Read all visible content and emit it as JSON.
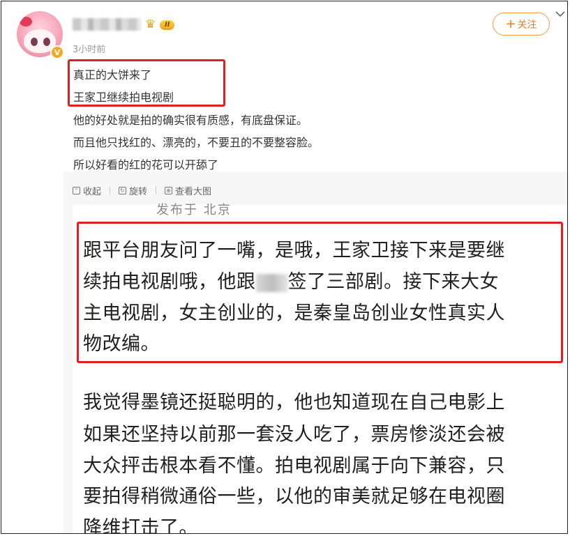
{
  "post": {
    "author_name": "",
    "level_badge": "II",
    "verified_badge": "V",
    "time": "3小时前",
    "follow_label": "关注",
    "lines": [
      "真正的大饼来了",
      "王家卫继续拍电视剧",
      "他的好处就是拍的确实很有质感，有底盘保证。",
      "而且他只找红的、漂亮的，不要丑的不要整容脸。",
      "所以好看的红的花可以开舔了"
    ]
  },
  "media_toolbar": {
    "collapse": "收起",
    "rotate": "旋转",
    "view_large": "查看大图"
  },
  "image_text": {
    "partial_top": "发布于 北京",
    "box_lines": [
      "跟平台朋友问了一嘴，是哦，王家卫接下来是要继",
      "续拍电视剧哦，他跟",
      "签了三部剧。接下来大女",
      "主电视剧，女主创业的，是秦皇岛创业女性真实人",
      "物改编。"
    ],
    "lower_lines": [
      "我觉得墨镜还挺聪明的，他也知道现在自己电影上",
      "如果还坚持以前那一套没人吃了，票房惨淡还会被",
      "大众抨击根本看不懂。拍电视剧属于向下兼容，只",
      "要拍得稍微通俗一些，以他的审美就足够在电视圈",
      "降维打击了。"
    ]
  },
  "colors": {
    "highlight_border": "#e02020",
    "follow_accent": "#f07a22"
  },
  "icons": [
    "avatar",
    "verified-icon",
    "crown-icon",
    "plus-icon",
    "chevron-down-icon",
    "collapse-icon",
    "rotate-icon",
    "view-large-icon"
  ]
}
